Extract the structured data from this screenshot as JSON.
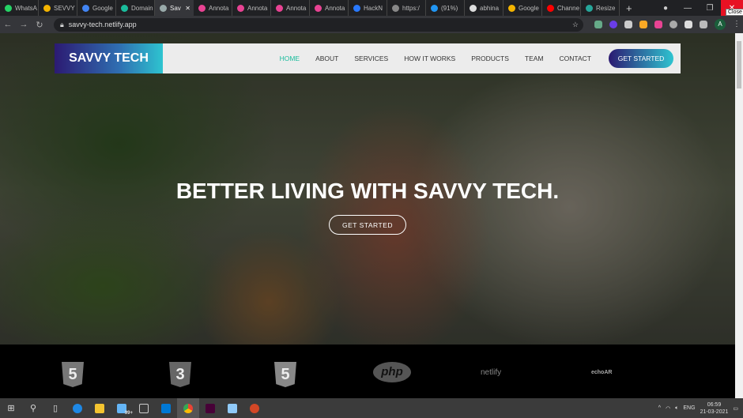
{
  "browser": {
    "tabs": [
      {
        "label": "WhatsA",
        "color": "#25d366"
      },
      {
        "label": "SEVVY",
        "color": "#f4b400"
      },
      {
        "label": "Google",
        "color": "#4285f4"
      },
      {
        "label": "Domain",
        "color": "#1abc9c"
      },
      {
        "label": "Sav",
        "color": "#9aa",
        "active": true
      },
      {
        "label": "Annota",
        "color": "#e84393"
      },
      {
        "label": "Annota",
        "color": "#e84393"
      },
      {
        "label": "Annota",
        "color": "#e84393"
      },
      {
        "label": "Annota",
        "color": "#e84393"
      },
      {
        "label": "HackN",
        "color": "#2979ff"
      },
      {
        "label": "https:/",
        "color": "#888"
      },
      {
        "label": "(91%)",
        "color": "#2196f3"
      },
      {
        "label": "abhina",
        "color": "#ddd"
      },
      {
        "label": "Google",
        "color": "#f4b400"
      },
      {
        "label": "Channe",
        "color": "#ff0000"
      },
      {
        "label": "Resize",
        "color": "#26a69a"
      }
    ],
    "url": "savvy-tech.netlify.app",
    "close_tooltip": "Close",
    "profile_initial": "A"
  },
  "site": {
    "logo": "SAVVY TECH",
    "menu": [
      "HOME",
      "ABOUT",
      "SERVICES",
      "HOW IT WORKS",
      "PRODUCTS",
      "TEAM",
      "CONTACT"
    ],
    "active_menu": "HOME",
    "cta": "GET STARTED",
    "headline": "BETTER LIVING WITH SAVVY TECH.",
    "hero_button": "GET STARTED",
    "accent": "#1abc9c",
    "tech_logos": [
      "html5",
      "css3",
      "html5",
      "php",
      "netlify",
      "echoAR"
    ],
    "logo_text": {
      "html": "5",
      "css": "3",
      "php": "php",
      "netlify": "netlify",
      "echoar": "echoAR",
      "css_label": "CSS"
    }
  },
  "taskbar": {
    "time": "06:59",
    "date": "21-03-2021",
    "lang": "ENG",
    "badge": "99+"
  }
}
